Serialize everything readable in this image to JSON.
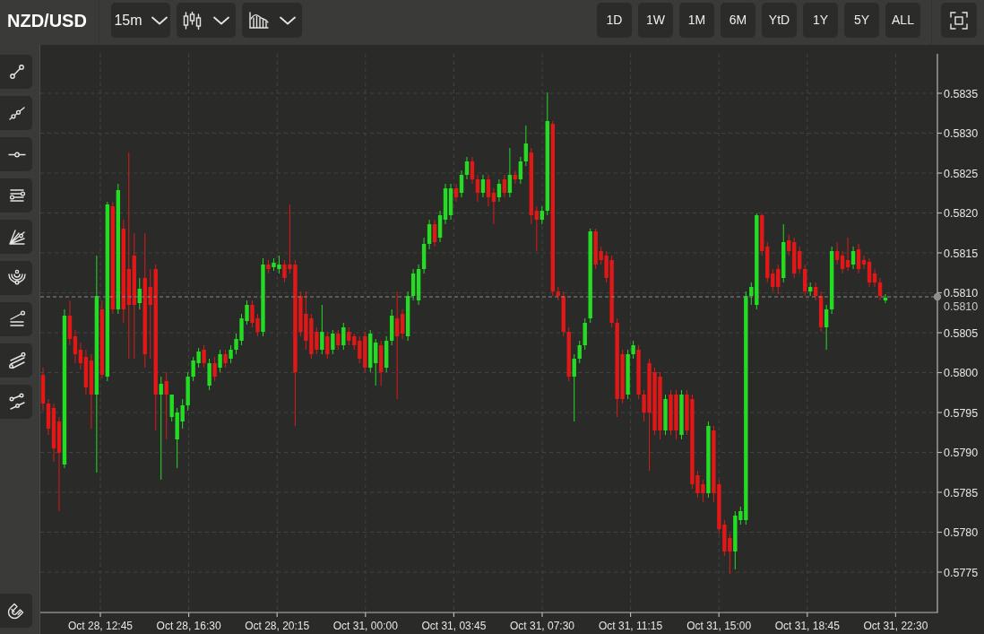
{
  "symbol": "NZD/USD",
  "interval_dropdown": {
    "value": "15m"
  },
  "range_buttons": [
    "1D",
    "1W",
    "1M",
    "6M",
    "YtD",
    "1Y",
    "5Y",
    "ALL"
  ],
  "chart": {
    "price_ticks": [
      "0.5835",
      "0.5830",
      "0.5825",
      "0.5820",
      "0.5815",
      "0.5810",
      "0.5805",
      "0.5800",
      "0.5795",
      "0.5790",
      "0.5785",
      "0.5780",
      "0.5775"
    ],
    "time_ticks": [
      "Oct 28, 12:45",
      "Oct 28, 16:30",
      "Oct 28, 20:15",
      "Oct 31, 00:00",
      "Oct 31, 03:45",
      "Oct 31, 07:30",
      "Oct 31, 11:15",
      "Oct 31, 15:00",
      "Oct 31, 18:45",
      "Oct 31, 22:30"
    ],
    "current_price": "0.5810"
  }
}
